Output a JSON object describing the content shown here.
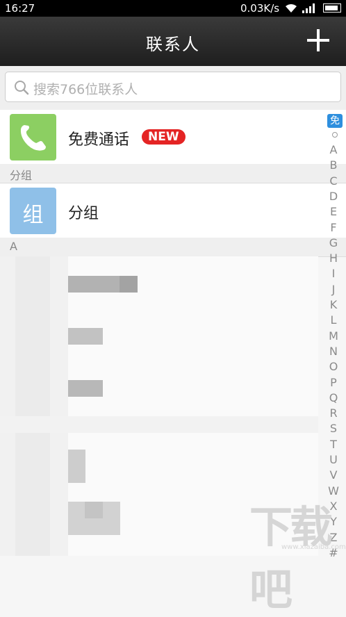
{
  "status_bar": {
    "time": "16:27",
    "speed": "0.03K/s"
  },
  "header": {
    "title": "联系人",
    "add_icon": "plus-icon"
  },
  "search": {
    "placeholder": "搜索766位联系人",
    "icon": "search-icon"
  },
  "free_call": {
    "label": "免费通话",
    "badge": "NEW",
    "icon": "phone-icon",
    "tile_color": "#8ccf62"
  },
  "sections": {
    "groups": "分组",
    "a": "A"
  },
  "groups_row": {
    "label": "分组",
    "tile_text": "组",
    "tile_color": "#8fc0e8"
  },
  "index": {
    "top_badge": "免",
    "letters": [
      "A",
      "B",
      "C",
      "D",
      "E",
      "F",
      "G",
      "H",
      "I",
      "J",
      "K",
      "L",
      "M",
      "N",
      "O",
      "P",
      "Q",
      "R",
      "S",
      "T",
      "U",
      "V",
      "W",
      "X",
      "Y",
      "Z",
      "#"
    ]
  },
  "watermark": {
    "text": "下载吧",
    "url": "www.xiazaiba.com"
  },
  "colors": {
    "badge_red": "#e42424",
    "index_badge_blue": "#2e8fde"
  }
}
